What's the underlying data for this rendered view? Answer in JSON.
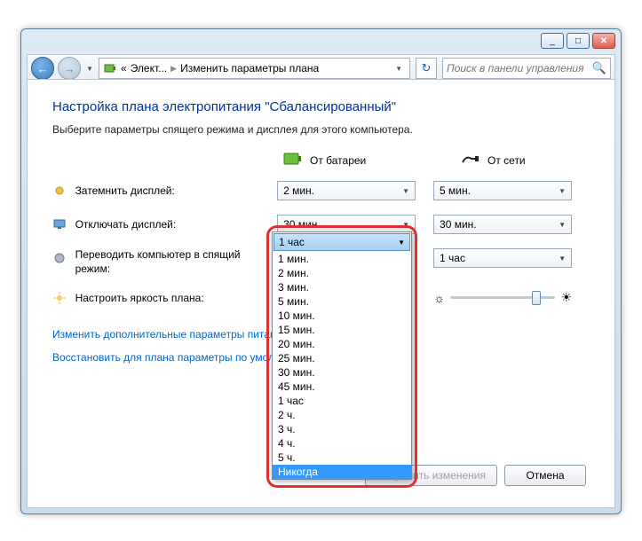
{
  "titlebar": {
    "min": "_",
    "max": "□",
    "close": "✕"
  },
  "nav": {
    "back": "←",
    "fwd": "→",
    "drop": "▼",
    "crumb1": "«",
    "crumb2": "Элект...",
    "crumb3": "Изменить параметры плана",
    "refresh": "↻"
  },
  "search": {
    "placeholder": "Поиск в панели управления"
  },
  "page": {
    "title": "Настройка плана электропитания \"Сбалансированный\"",
    "sub": "Выберите параметры спящего режима и дисплея для этого компьютера."
  },
  "cols": {
    "battery": "От батареи",
    "mains": "От сети"
  },
  "rows": {
    "dim": {
      "label": "Затемнить дисплей:",
      "batt": "2 мин.",
      "mains": "5 мин."
    },
    "off": {
      "label": "Отключать дисплей:",
      "batt": "30 мин.",
      "mains": "30 мин."
    },
    "sleep": {
      "label": "Переводить компьютер в спящий режим:",
      "batt": "1 час",
      "mains": "1 час"
    },
    "bright": {
      "label": "Настроить яркость плана:"
    }
  },
  "dropdown": {
    "selected": "1 час",
    "items": [
      "1 мин.",
      "2 мин.",
      "3 мин.",
      "5 мин.",
      "10 мин.",
      "15 мин.",
      "20 мин.",
      "25 мин.",
      "30 мин.",
      "45 мин.",
      "1 час",
      "2 ч.",
      "3 ч.",
      "4 ч.",
      "5 ч.",
      "Никогда"
    ],
    "highlight_index": 15
  },
  "links": {
    "adv": "Изменить дополнительные параметры питания",
    "restore": "Восстановить для плана параметры по умолчанию"
  },
  "buttons": {
    "save": "Сохранить изменения",
    "cancel": "Отмена"
  }
}
